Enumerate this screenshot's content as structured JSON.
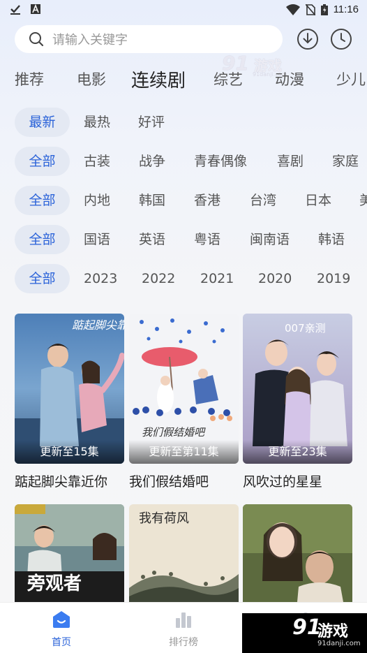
{
  "status_bar": {
    "time": "11:16",
    "icons": [
      "download-done-icon",
      "text-a-icon",
      "wifi-icon",
      "no-sim-icon",
      "battery-icon"
    ]
  },
  "search": {
    "placeholder": "请输入关键字",
    "icons": [
      "search-icon",
      "download-icon",
      "history-icon"
    ]
  },
  "watermark": {
    "logo": "91游戏",
    "url": "91danji.com"
  },
  "tabs": [
    {
      "label": "推荐",
      "active": false
    },
    {
      "label": "电影",
      "active": false
    },
    {
      "label": "连续剧",
      "active": true
    },
    {
      "label": "综艺",
      "active": false
    },
    {
      "label": "动漫",
      "active": false
    },
    {
      "label": "少儿",
      "active": false
    }
  ],
  "filters": {
    "sort": [
      "最新",
      "最热",
      "好评"
    ],
    "genre": [
      "全部",
      "古装",
      "战争",
      "青春偶像",
      "喜剧",
      "家庭"
    ],
    "region": [
      "全部",
      "内地",
      "韩国",
      "香港",
      "台湾",
      "日本",
      "美"
    ],
    "language": [
      "全部",
      "国语",
      "英语",
      "粤语",
      "闽南语",
      "韩语"
    ],
    "year": [
      "全部",
      "2023",
      "2022",
      "2021",
      "2020",
      "2019"
    ]
  },
  "shows": [
    {
      "title": "踮起脚尖靠近你",
      "badge": "更新至15集",
      "poster_art": "踮起脚尖靠近你"
    },
    {
      "title": "我们假结婚吧",
      "badge": "更新至第11集",
      "poster_art": "我们假结婚吧"
    },
    {
      "title": "风吹过的星星",
      "badge": "更新至23集",
      "poster_art": "007亲测"
    },
    {
      "title": "",
      "badge": "",
      "poster_art": "旁观者"
    },
    {
      "title": "",
      "badge": "",
      "poster_art": "我有荷风"
    },
    {
      "title": "",
      "badge": "",
      "poster_art": ""
    }
  ],
  "bottom_nav": [
    {
      "label": "首页",
      "icon": "home-icon",
      "active": true
    },
    {
      "label": "排行榜",
      "icon": "ranking-icon",
      "active": false
    },
    {
      "label": "",
      "icon": "profile-icon",
      "active": false
    }
  ],
  "colors": {
    "accent": "#2b63d9",
    "chip_bg": "#e4e9f3",
    "text": "#333333"
  }
}
